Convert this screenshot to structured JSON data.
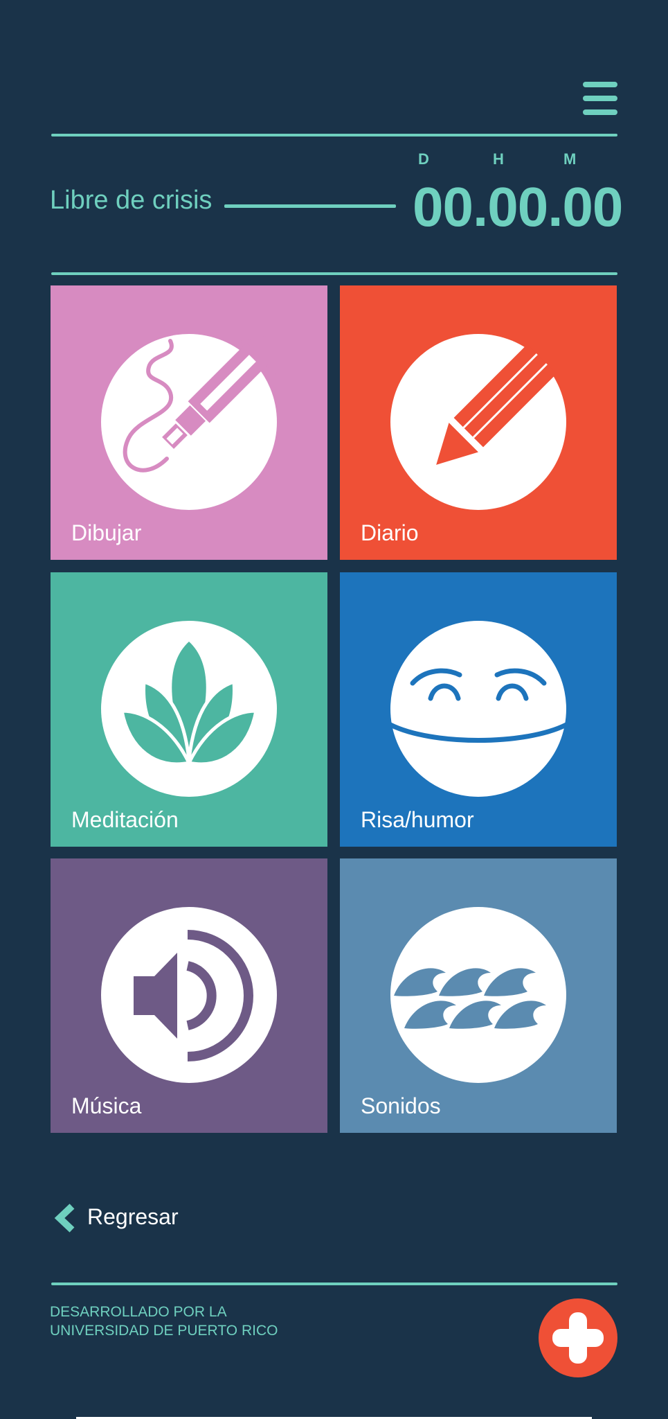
{
  "header": {
    "menu_icon": "hamburger-menu-icon"
  },
  "timer": {
    "label": "Libre de crisis",
    "units": [
      "D",
      "H",
      "M"
    ],
    "value": "00.00.00"
  },
  "tiles": [
    {
      "label": "Dibujar",
      "color": "#d78bc1",
      "icon": "pen-drawing-icon"
    },
    {
      "label": "Diario",
      "color": "#ef5036",
      "icon": "pencil-icon"
    },
    {
      "label": "Meditación",
      "color": "#4db6a1",
      "icon": "lotus-icon"
    },
    {
      "label": "Risa/humor",
      "color": "#1d74bc",
      "icon": "smiling-face-icon"
    },
    {
      "label": "Música",
      "color": "#6e5a86",
      "icon": "speaker-icon"
    },
    {
      "label": "Sonidos",
      "color": "#5b8bb0",
      "icon": "waves-icon"
    }
  ],
  "back": {
    "label": "Regresar",
    "icon": "chevron-left-icon"
  },
  "footer": {
    "credit_line1": "DESARROLLADO POR LA",
    "credit_line2": "UNIVERSIDAD DE PUERTO RICO",
    "emergency_icon": "plus-cross-icon"
  },
  "colors": {
    "background": "#1a3349",
    "accent": "#6fd0bf",
    "emergency": "#ef5036"
  }
}
